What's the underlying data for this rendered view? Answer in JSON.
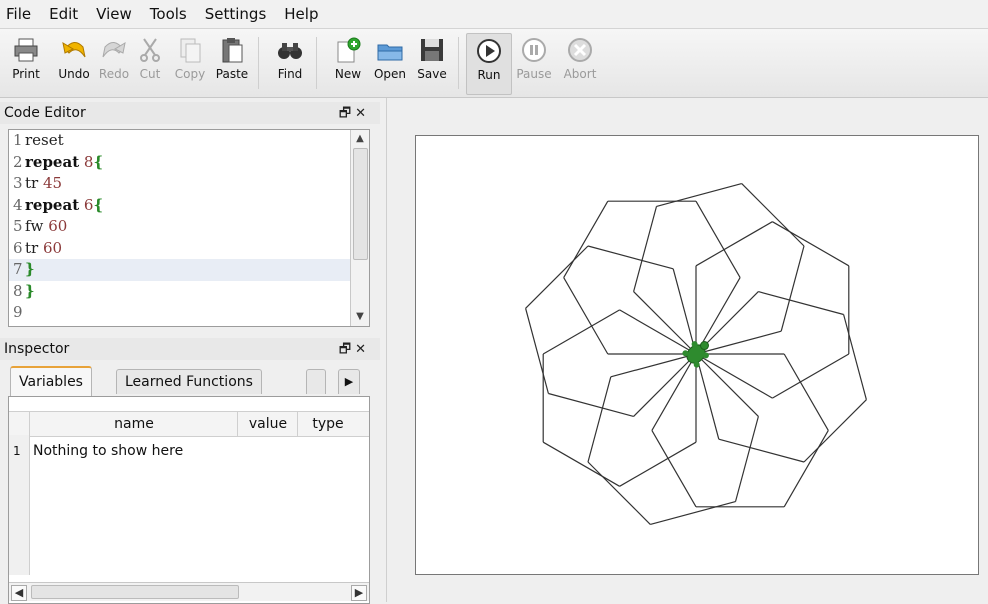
{
  "menu": [
    "File",
    "Edit",
    "View",
    "Tools",
    "Settings",
    "Help"
  ],
  "toolbar": {
    "print": "Print",
    "undo": "Undo",
    "redo": "Redo",
    "cut": "Cut",
    "copy": "Copy",
    "paste": "Paste",
    "find": "Find",
    "new": "New",
    "open": "Open",
    "save": "Save",
    "run": "Run",
    "pause": "Pause",
    "abort": "Abort"
  },
  "code_editor": {
    "title": "Code Editor",
    "lines": [
      {
        "n": "1",
        "cmd": "reset",
        "arg": "",
        "brace": "",
        "kw": false
      },
      {
        "n": "2",
        "cmd": "repeat",
        "arg": "8",
        "brace": "{",
        "kw": true
      },
      {
        "n": "3",
        "cmd": "tr",
        "arg": "45",
        "brace": "",
        "kw": false
      },
      {
        "n": "4",
        "cmd": "repeat",
        "arg": "6",
        "brace": "{",
        "kw": true
      },
      {
        "n": "5",
        "cmd": "fw",
        "arg": "60",
        "brace": "",
        "kw": false
      },
      {
        "n": "6",
        "cmd": "tr",
        "arg": "60",
        "brace": "",
        "kw": false
      },
      {
        "n": "7",
        "cmd": "",
        "arg": "",
        "brace": "}",
        "kw": false
      },
      {
        "n": "8",
        "cmd": "",
        "arg": "",
        "brace": "}",
        "kw": false
      },
      {
        "n": "9",
        "cmd": "",
        "arg": "",
        "brace": "",
        "kw": false
      }
    ],
    "current_line": 7
  },
  "inspector": {
    "title": "Inspector",
    "tabs": [
      "Variables",
      "Learned Functions"
    ],
    "columns": [
      "name",
      "value",
      "type"
    ],
    "rows": [
      {
        "n": "1",
        "text": "Nothing to show here"
      }
    ]
  },
  "drawing": {
    "outer_repeat": 8,
    "outer_turn": 45,
    "inner_repeat": 6,
    "step": 60,
    "inner_turn": 60
  },
  "colors": {
    "turtle": "#2e8b2e",
    "line": "#333333",
    "tab_accent": "#e8a33a"
  }
}
